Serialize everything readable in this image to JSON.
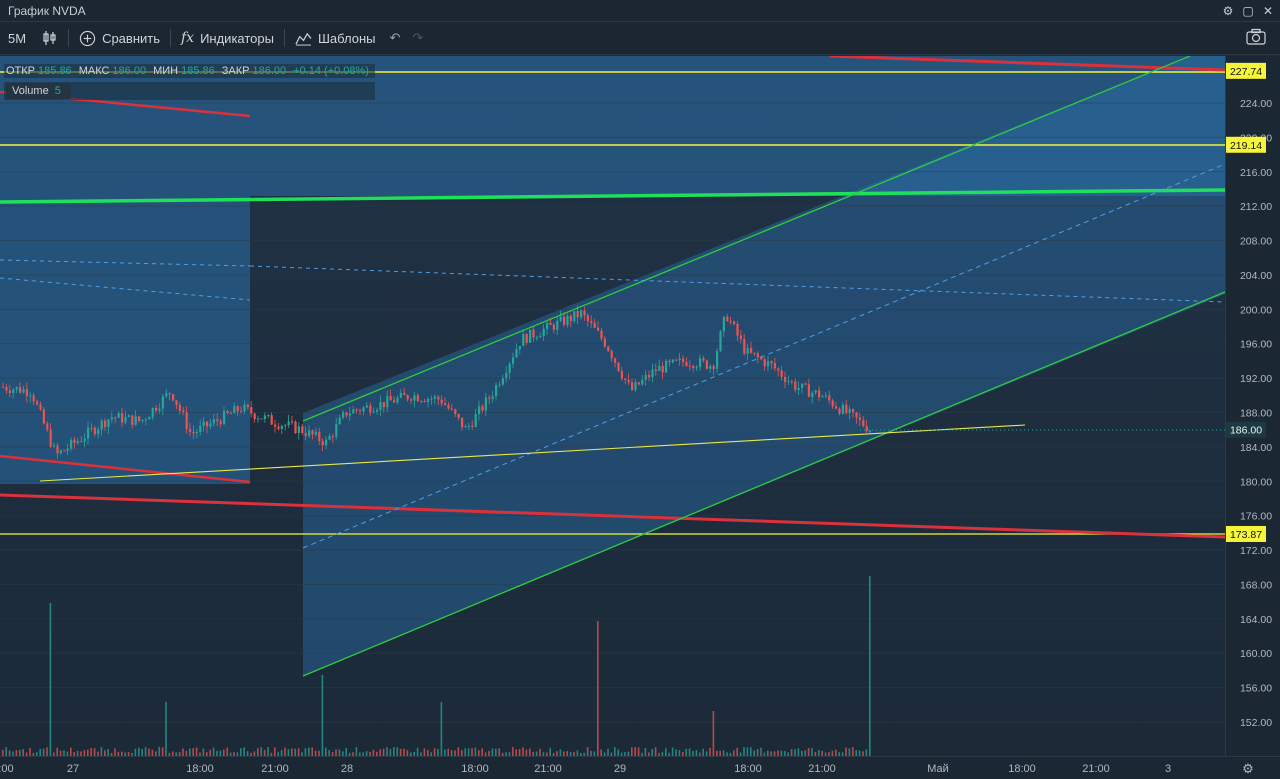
{
  "window": {
    "title": "График NVDA"
  },
  "toolbar": {
    "interval": "5M",
    "compare_label": "Сравнить",
    "indicators_label": "Индикаторы",
    "templates_label": "Шаблоны"
  },
  "legend": {
    "open_label": "ОТКР",
    "open_value": "185.86",
    "high_label": "МАКС",
    "high_value": "186.00",
    "low_label": "МИН",
    "low_value": "185.86",
    "close_label": "ЗАКР",
    "close_value": "186.00",
    "change_value": "+0.14 (+0.08%)",
    "volume_label": "Volume",
    "volume_value": "5"
  },
  "price_axis": {
    "ticks": [
      "224.00",
      "220.00",
      "216.00",
      "212.00",
      "208.00",
      "204.00",
      "200.00",
      "196.00",
      "192.00",
      "188.00",
      "184.00",
      "180.00",
      "176.00",
      "172.00",
      "168.00",
      "164.00",
      "160.00",
      "156.00",
      "152.00"
    ],
    "badges": [
      {
        "label": "227.74",
        "kind": "yellow"
      },
      {
        "label": "219.14",
        "kind": "yellow"
      },
      {
        "label": "186.00",
        "kind": "teal"
      },
      {
        "label": "173.87",
        "kind": "yellow"
      }
    ]
  },
  "time_axis": {
    "labels": [
      ":00",
      "27",
      "18:00",
      "21:00",
      "28",
      "18:00",
      "21:00",
      "29",
      "18:00",
      "21:00",
      "Май",
      "18:00",
      "21:00",
      "3"
    ]
  },
  "colors": {
    "bull": "#26a69a",
    "bear": "#ef5350",
    "support_resistance": "#f5f53a",
    "channel": "#2ecc40",
    "trend_red": "#d9323c",
    "zone": "#2a6fa8"
  },
  "chart_data": {
    "type": "candlestick",
    "symbol": "NVDA",
    "interval": "5M",
    "ylim": [
      148,
      230
    ],
    "last_close": 186.0,
    "horizontal_levels": [
      227.74,
      219.14,
      173.87
    ],
    "candles_approx": [
      {
        "t": 0,
        "c": 191.0
      },
      {
        "t": 30,
        "c": 190.5
      },
      {
        "t": 55,
        "c": 183.0
      },
      {
        "t": 80,
        "c": 185.0
      },
      {
        "t": 110,
        "c": 187.5
      },
      {
        "t": 140,
        "c": 187.0
      },
      {
        "t": 170,
        "c": 190.5
      },
      {
        "t": 190,
        "c": 185.5
      },
      {
        "t": 215,
        "c": 187.0
      },
      {
        "t": 240,
        "c": 188.5
      },
      {
        "t": 270,
        "c": 187.0
      },
      {
        "t": 300,
        "c": 186.0
      },
      {
        "t": 325,
        "c": 184.5
      },
      {
        "t": 345,
        "c": 188.0
      },
      {
        "t": 380,
        "c": 189.0
      },
      {
        "t": 410,
        "c": 190.0
      },
      {
        "t": 440,
        "c": 189.5
      },
      {
        "t": 465,
        "c": 186.0
      },
      {
        "t": 490,
        "c": 190.0
      },
      {
        "t": 520,
        "c": 196.5
      },
      {
        "t": 550,
        "c": 198.0
      },
      {
        "t": 580,
        "c": 199.5
      },
      {
        "t": 605,
        "c": 196.0
      },
      {
        "t": 630,
        "c": 190.5
      },
      {
        "t": 655,
        "c": 193.0
      },
      {
        "t": 685,
        "c": 194.0
      },
      {
        "t": 712,
        "c": 193.5
      },
      {
        "t": 725,
        "c": 199.5
      },
      {
        "t": 745,
        "c": 195.0
      },
      {
        "t": 770,
        "c": 193.5
      },
      {
        "t": 795,
        "c": 191.0
      },
      {
        "t": 820,
        "c": 190.0
      },
      {
        "t": 845,
        "c": 188.0
      },
      {
        "t": 870,
        "c": 186.0
      }
    ],
    "volume_spikes_approx": [
      {
        "t": 50,
        "v": 0.85
      },
      {
        "t": 165,
        "v": 0.3
      },
      {
        "t": 322,
        "v": 0.45
      },
      {
        "t": 440,
        "v": 0.3
      },
      {
        "t": 598,
        "v": 0.75
      },
      {
        "t": 712,
        "v": 0.25
      },
      {
        "t": 870,
        "v": 1.0
      }
    ]
  }
}
